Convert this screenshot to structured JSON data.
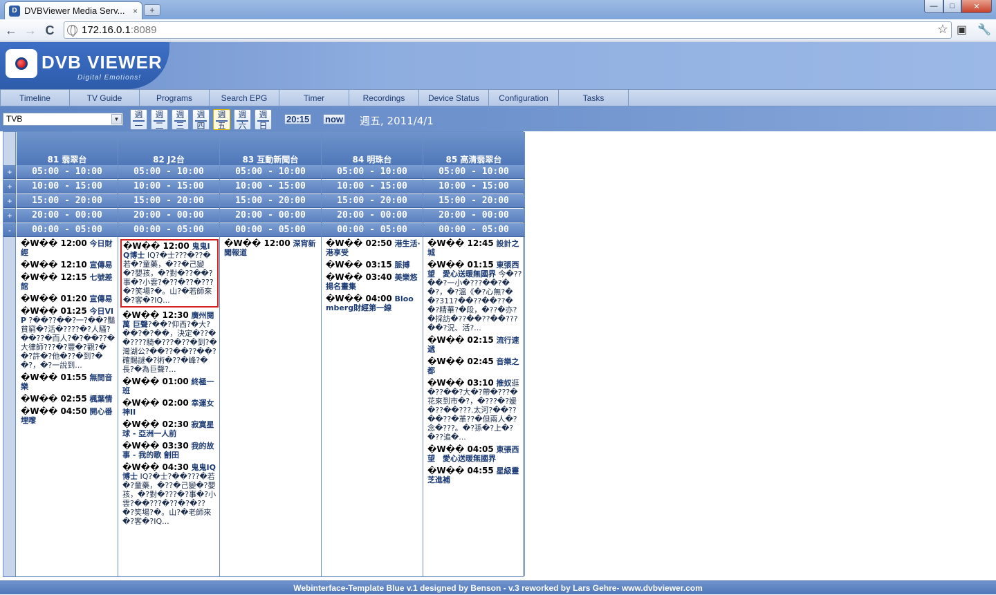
{
  "browser": {
    "tab_title": "DVBViewer Media Serv...",
    "tab_close": "×",
    "new_tab": "+",
    "url_host": "172.16.0.1",
    "url_port": ":8089",
    "back": "←",
    "forward": "→",
    "reload": "C",
    "bookmark": "☆",
    "wrench": "🔧",
    "page_action": "▣",
    "minimize": "—",
    "maximize": "□",
    "close": "✕"
  },
  "header": {
    "logo_text": "DVB VIEWER",
    "tagline": "Digital Emotions!"
  },
  "menu": [
    "Timeline",
    "TV Guide",
    "Programs",
    "Search EPG",
    "Timer",
    "Recordings",
    "Device Status",
    "Configuration",
    "Tasks"
  ],
  "controls": {
    "channel": "TVB",
    "select_arrow": "▼",
    "days": [
      "週一",
      "週二",
      "週三",
      "週四",
      "週五",
      "週六",
      "週日"
    ],
    "active_day_index": 4,
    "time": "20:15",
    "now": "now",
    "date": "週五, 2011/4/1"
  },
  "grid": {
    "channels": [
      "81 翡翠台",
      "82 J2台",
      "83 互動新聞台",
      "84 明珠台",
      "85 高清翡翠台"
    ],
    "slots": [
      {
        "label": "05:00 - 10:00",
        "toggle": "+"
      },
      {
        "label": "10:00 - 15:00",
        "toggle": "+"
      },
      {
        "label": "15:00 - 20:00",
        "toggle": "+"
      },
      {
        "label": "20:00 - 00:00",
        "toggle": "+"
      },
      {
        "label": "00:00 - 05:00",
        "toggle": "-"
      }
    ],
    "programs": [
      [
        {
          "head": "�W�� 12:00",
          "title": " 今日財經",
          "desc": ""
        },
        {
          "head": "�W�� 12:10",
          "title": " 宣傳易",
          "desc": ""
        },
        {
          "head": "�W�� 12:15",
          "title": " 七號差館",
          "desc": ""
        },
        {
          "head": "�W�� 01:20",
          "title": " 宣傳易",
          "desc": ""
        },
        {
          "head": "�W�� 01:25",
          "title": " 今日VIP",
          "desc": " ?��??��?一?��?豔貧窮�?活�????�?人騷?��??�而人?�?��??�大律師???�?豐�?觀?��?許�?他�??�到?��?，�?一說到..."
        },
        {
          "head": "�W�� 01:55",
          "title": " 無間音樂",
          "desc": ""
        },
        {
          "head": "�W�� 02:55",
          "title": " 楓葉情",
          "desc": ""
        },
        {
          "head": "�W�� 04:50",
          "title": " 開心番埋嚟",
          "desc": ""
        }
      ],
      [
        {
          "head": "�W�� 12:00",
          "title": " 鬼鬼IQ博士",
          "desc": " IQ?�士???�??�若�?童藥，�??�己變�?嬰孩，�?對�??��?事�?小雲?�??�??�???�?笑場?�。山?�若師來�?客�?IQ...",
          "selected": true
        },
        {
          "head": "�W�� 12:30",
          "title": " 廣州閱萬 巨聲",
          "desc": "?��?仰西?�大?��?�?��，決定�??��????騎�???�??�到?�灣湖公?��??��??��?確賜謎�?術�??�峰?�長?�為巨聲?..."
        },
        {
          "head": "�W�� 01:00",
          "title": " 終極一班",
          "desc": ""
        },
        {
          "head": "�W�� 02:00",
          "title": " 幸運女神II",
          "desc": ""
        },
        {
          "head": "�W�� 02:30",
          "title": " 寂寞星球 - 亞洲一人前",
          "desc": ""
        },
        {
          "head": "�W�� 03:30",
          "title": " 我的故事 - 我的歌 劊田",
          "desc": ""
        },
        {
          "head": "�W�� 04:30",
          "title": " 鬼鬼IQ博士",
          "desc": " IQ?�士?��???�若�?童藥，�??�己變�?嬰孩，�?對�???�?事�?小雲?��???�??�?�??�?笑場?�。山?�老師來�?客�?IQ..."
        }
      ],
      [
        {
          "head": "�W�� 12:00",
          "title": " 深宵新聞報道",
          "desc": ""
        }
      ],
      [
        {
          "head": "�W�� 02:50",
          "title": " 港生活·港享受",
          "desc": ""
        },
        {
          "head": "�W�� 03:15",
          "title": " 脈搏",
          "desc": ""
        },
        {
          "head": "�W�� 03:40",
          "title": " 美樂悠揚名畫集",
          "desc": ""
        },
        {
          "head": "�W�� 04:00",
          "title": " Bloomberg財經第一線",
          "desc": ""
        }
      ],
      [
        {
          "head": "�W�� 12:45",
          "title": " 設計之城",
          "desc": ""
        },
        {
          "head": "�W�� 01:15",
          "title": " 東張西望　愛心送暖無國界",
          "desc": " 今�??��?一小�???��?��?，�?溫《�?心無?��?311?��??��??��?精華?�段，�??�亦?�採訪�??��??��???��?況、活?..."
        },
        {
          "head": "�W�� 02:15",
          "title": " 流行速遞",
          "desc": ""
        },
        {
          "head": "�W�� 02:45",
          "title": " 音樂之都",
          "desc": ""
        },
        {
          "head": "�W�� 03:10",
          "title": " 推奴",
          "desc": "逛�??��?大�?帶�???�花來到市�?，�???�?媛�??��???.太河?��??��??�革??�但兩人�?念�???。�?孫�?上�?�??追�..."
        },
        {
          "head": "�W�� 04:05",
          "title": " 東張西望　愛心送暖無國界",
          "desc": ""
        },
        {
          "head": "�W�� 04:55",
          "title": " 星級靈芝進補",
          "desc": ""
        }
      ]
    ]
  },
  "footer": "Webinterface-Template Blue v.1 designed by Benson - v.3 reworked by Lars Gehre- www.dvbviewer.com",
  "colors": {
    "brand_blue": "#2e5cab",
    "header_blue": "#6c8fcc",
    "slot_blue": "#5a80be",
    "link_text": "#1b3a74",
    "selection_red": "#d62020"
  }
}
